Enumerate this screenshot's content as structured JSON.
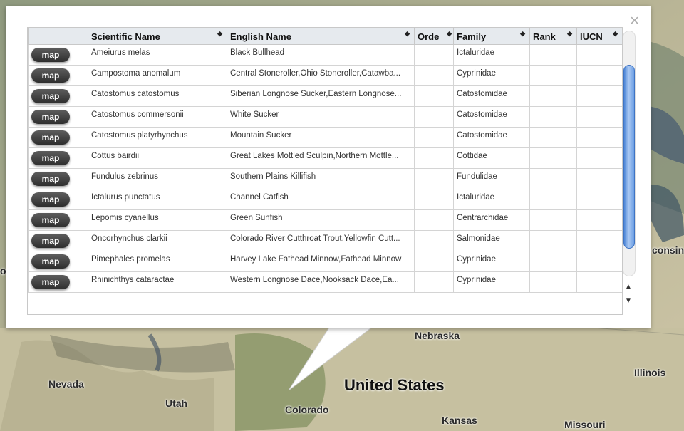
{
  "map": {
    "labels": [
      {
        "id": "nebraska",
        "text": "Nebraska"
      },
      {
        "id": "nevada",
        "text": "Nevada"
      },
      {
        "id": "utah",
        "text": "Utah"
      },
      {
        "id": "united-states",
        "text": "United States"
      },
      {
        "id": "colorado",
        "text": "Colorado"
      },
      {
        "id": "kansas",
        "text": "Kansas"
      },
      {
        "id": "illinois",
        "text": "Illinois"
      },
      {
        "id": "missouri",
        "text": "Missouri"
      },
      {
        "id": "wisconsin",
        "text": "consin"
      },
      {
        "id": "left-edge",
        "text": "o"
      }
    ]
  },
  "popup": {
    "close_glyph": "×",
    "columns": [
      "",
      "Scientific Name",
      "English Name",
      "Orde",
      "Family",
      "Rank",
      "IUCN"
    ],
    "sort_glyph": "◆",
    "map_button_label": "map",
    "rows": [
      {
        "sci": "Ameiurus melas",
        "eng": "Black Bullhead",
        "order": "",
        "family": "Ictaluridae",
        "rank": "",
        "iucn": ""
      },
      {
        "sci": "Campostoma anomalum",
        "eng": "Central Stoneroller,Ohio Stoneroller,Catawba...",
        "order": "",
        "family": "Cyprinidae",
        "rank": "",
        "iucn": ""
      },
      {
        "sci": "Catostomus catostomus",
        "eng": "Siberian Longnose Sucker,Eastern Longnose...",
        "order": "",
        "family": "Catostomidae",
        "rank": "",
        "iucn": ""
      },
      {
        "sci": "Catostomus commersonii",
        "eng": "White Sucker",
        "order": "",
        "family": "Catostomidae",
        "rank": "",
        "iucn": ""
      },
      {
        "sci": "Catostomus platyrhynchus",
        "eng": "Mountain Sucker",
        "order": "",
        "family": "Catostomidae",
        "rank": "",
        "iucn": ""
      },
      {
        "sci": "Cottus bairdii",
        "eng": "Great Lakes Mottled Sculpin,Northern Mottle...",
        "order": "",
        "family": "Cottidae",
        "rank": "",
        "iucn": ""
      },
      {
        "sci": "Fundulus zebrinus",
        "eng": "Southern Plains Killifish",
        "order": "",
        "family": "Fundulidae",
        "rank": "",
        "iucn": ""
      },
      {
        "sci": "Ictalurus punctatus",
        "eng": "Channel Catfish",
        "order": "",
        "family": "Ictaluridae",
        "rank": "",
        "iucn": ""
      },
      {
        "sci": "Lepomis cyanellus",
        "eng": "Green Sunfish",
        "order": "",
        "family": "Centrarchidae",
        "rank": "",
        "iucn": ""
      },
      {
        "sci": "Oncorhynchus clarkii",
        "eng": "Colorado River Cutthroat Trout,Yellowfin Cutt...",
        "order": "",
        "family": "Salmonidae",
        "rank": "",
        "iucn": ""
      },
      {
        "sci": "Pimephales promelas",
        "eng": "Harvey Lake Fathead Minnow,Fathead Minnow",
        "order": "",
        "family": "Cyprinidae",
        "rank": "",
        "iucn": ""
      },
      {
        "sci": "Rhinichthys cataractae",
        "eng": "Western Longnose Dace,Nooksack Dace,Ea...",
        "order": "",
        "family": "Cyprinidae",
        "rank": "",
        "iucn": ""
      }
    ],
    "scroll_up_glyph": "▲",
    "scroll_down_glyph": "▼"
  },
  "colors": {
    "scroll_thumb": "#4d86d8",
    "button": "#3a3a3a",
    "header_bg": "#e6eaee"
  }
}
